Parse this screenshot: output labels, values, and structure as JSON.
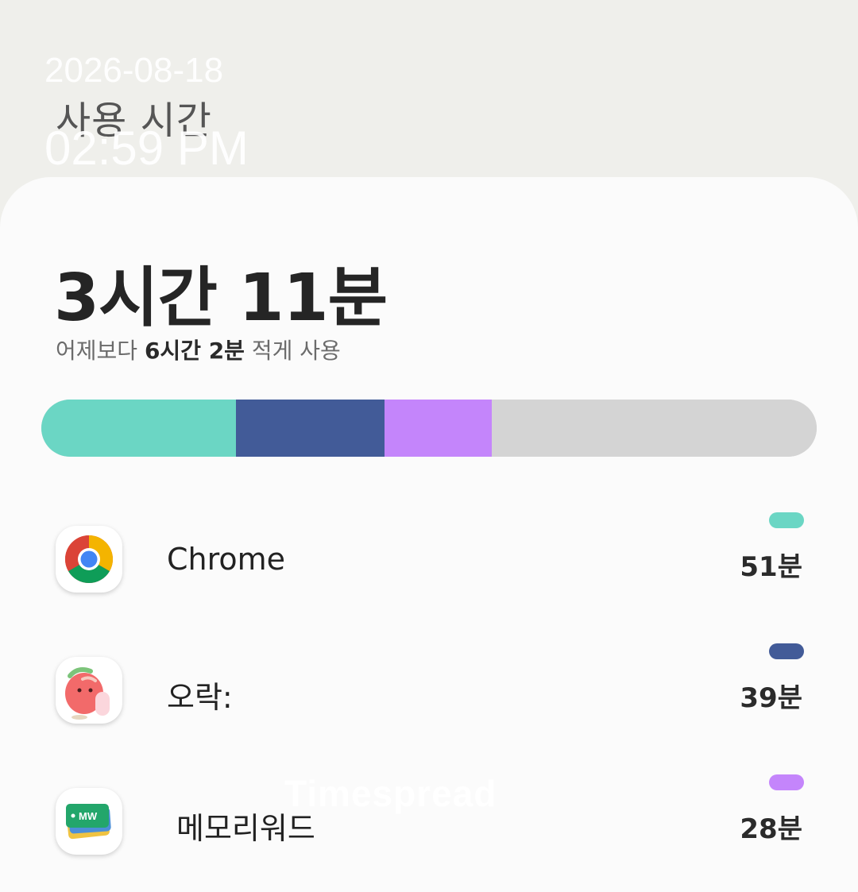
{
  "header": {
    "title": "사용 시간"
  },
  "stamp": {
    "date": "2026-08-18",
    "time": "02:59 PM"
  },
  "summary": {
    "total": "3시간 11분",
    "compare_prefix": "어제보다 ",
    "compare_value": "6시간 2분",
    "compare_suffix": " 적게 사용"
  },
  "usage_bar": {
    "total_minutes": 191,
    "segments": [
      {
        "app": "Chrome",
        "minutes": 51,
        "color": "#6bd6c4"
      },
      {
        "app": "오락:",
        "minutes": 39,
        "color": "#425b98"
      },
      {
        "app": "메모리워드",
        "minutes": 28,
        "color": "#c485fb"
      }
    ],
    "remainder_color": "#d4d4d4"
  },
  "apps": [
    {
      "name": "Chrome",
      "time": "51분",
      "color": "#6bd6c4",
      "icon": "chrome-icon"
    },
    {
      "name": "오락:",
      "time": "39분",
      "color": "#425b98",
      "icon": "orak-character-icon"
    },
    {
      "name": "메모리워드",
      "time": "28분",
      "color": "#c485fb",
      "icon": "memoryword-card-icon",
      "icon_text": "MW"
    }
  ],
  "watermark": {
    "text": "Timespread"
  }
}
